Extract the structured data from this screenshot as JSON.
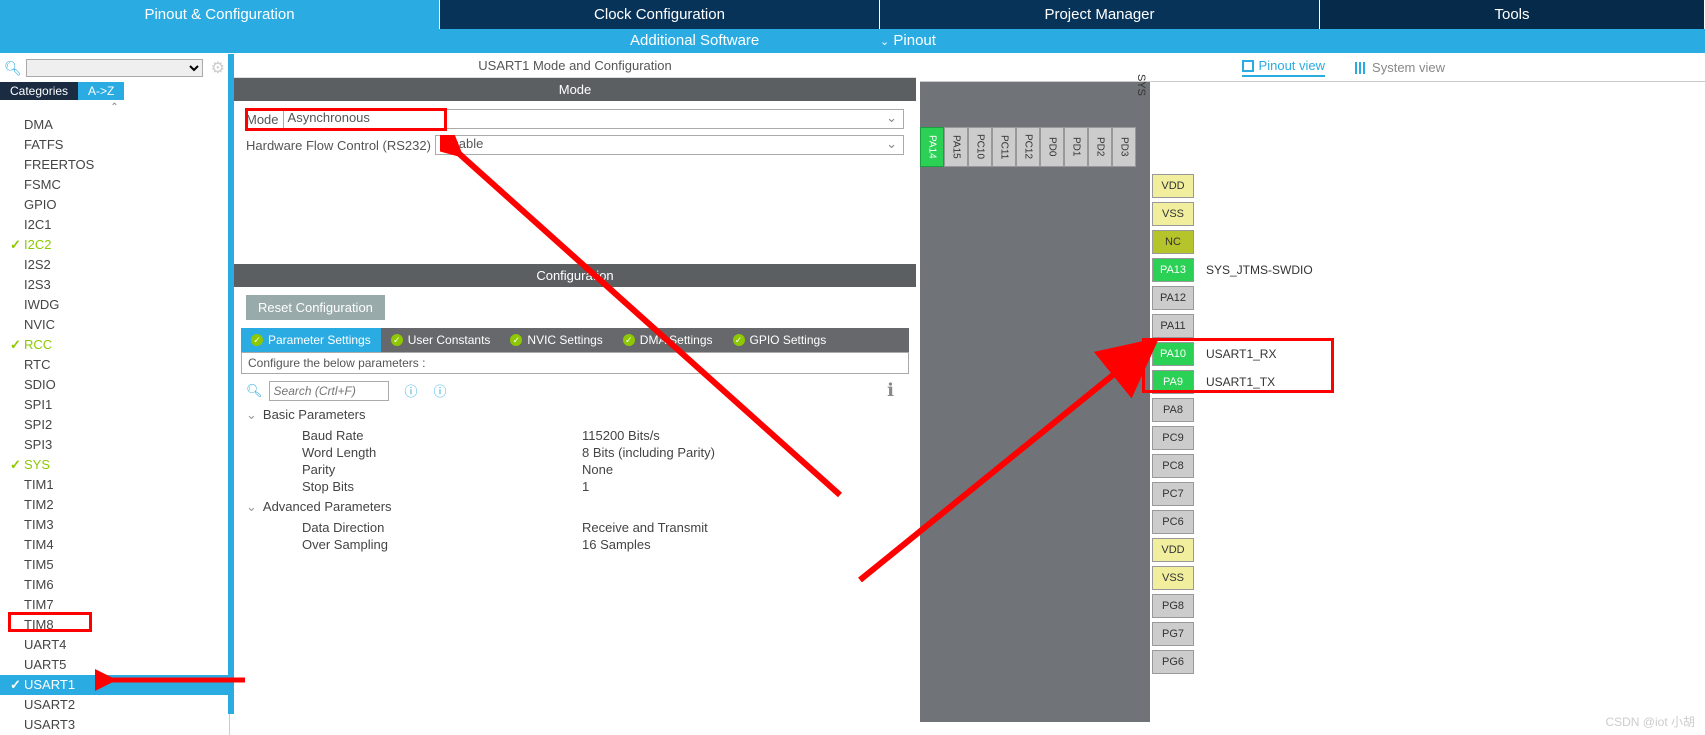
{
  "tabs": {
    "pinout": "Pinout & Configuration",
    "clock": "Clock Configuration",
    "project": "Project Manager",
    "tools": "Tools"
  },
  "sub": {
    "addsoft": "Additional Software",
    "pinout": "Pinout"
  },
  "left": {
    "cat": "Categories",
    "az": "A->Z",
    "items": [
      {
        "t": "DMA"
      },
      {
        "t": "FATFS"
      },
      {
        "t": "FREERTOS"
      },
      {
        "t": "FSMC"
      },
      {
        "t": "GPIO"
      },
      {
        "t": "I2C1"
      },
      {
        "t": "I2C2",
        "c": true
      },
      {
        "t": "I2S2"
      },
      {
        "t": "I2S3"
      },
      {
        "t": "IWDG"
      },
      {
        "t": "NVIC"
      },
      {
        "t": "RCC",
        "c": true
      },
      {
        "t": "RTC"
      },
      {
        "t": "SDIO"
      },
      {
        "t": "SPI1"
      },
      {
        "t": "SPI2"
      },
      {
        "t": "SPI3"
      },
      {
        "t": "SYS",
        "c": true
      },
      {
        "t": "TIM1"
      },
      {
        "t": "TIM2"
      },
      {
        "t": "TIM3"
      },
      {
        "t": "TIM4"
      },
      {
        "t": "TIM5"
      },
      {
        "t": "TIM6"
      },
      {
        "t": "TIM7"
      },
      {
        "t": "TIM8"
      },
      {
        "t": "UART4"
      },
      {
        "t": "UART5"
      },
      {
        "t": "USART1",
        "c": true,
        "sel": true
      },
      {
        "t": "USART2"
      },
      {
        "t": "USART3"
      }
    ]
  },
  "mid": {
    "title": "USART1 Mode and Configuration",
    "modehdr": "Mode",
    "mode_lbl": "Mode",
    "mode_val": "Asynchronous",
    "hw_lbl": "Hardware Flow Control (RS232)",
    "hw_val": "Disable",
    "confighdr": "Configuration",
    "reset": "Reset Configuration",
    "tabs": [
      "Parameter Settings",
      "User Constants",
      "NVIC Settings",
      "DMA Settings",
      "GPIO Settings"
    ],
    "desc": "Configure the below parameters :",
    "search_ph": "Search (Crtl+F)",
    "groups": {
      "basic": "Basic Parameters",
      "adv": "Advanced Parameters"
    },
    "params": [
      {
        "n": "Baud Rate",
        "v": "115200 Bits/s"
      },
      {
        "n": "Word Length",
        "v": "8 Bits (including Parity)"
      },
      {
        "n": "Parity",
        "v": "None"
      },
      {
        "n": "Stop Bits",
        "v": "1"
      }
    ],
    "params2": [
      {
        "n": "Data Direction",
        "v": "Receive and Transmit"
      },
      {
        "n": "Over Sampling",
        "v": "16 Samples"
      }
    ]
  },
  "right": {
    "pinoutview": "Pinout view",
    "systemview": "System view",
    "sys": "SYS",
    "top_pins": [
      "PD3",
      "PD2",
      "PD1",
      "PD0",
      "PC12",
      "PC11",
      "PC10",
      "PA15",
      "PA14"
    ],
    "side_pins": [
      {
        "p": "VDD",
        "cls": "yellow"
      },
      {
        "p": "VSS",
        "cls": "yellow"
      },
      {
        "p": "NC",
        "cls": "olive"
      },
      {
        "p": "PA13",
        "cls": "green",
        "lbl": "SYS_JTMS-SWDIO"
      },
      {
        "p": "PA12",
        "cls": ""
      },
      {
        "p": "PA11",
        "cls": ""
      },
      {
        "p": "PA10",
        "cls": "green",
        "lbl": "USART1_RX"
      },
      {
        "p": "PA9",
        "cls": "green",
        "lbl": "USART1_TX"
      },
      {
        "p": "PA8",
        "cls": ""
      },
      {
        "p": "PC9",
        "cls": ""
      },
      {
        "p": "PC8",
        "cls": ""
      },
      {
        "p": "PC7",
        "cls": ""
      },
      {
        "p": "PC6",
        "cls": ""
      },
      {
        "p": "VDD",
        "cls": "yellow"
      },
      {
        "p": "VSS",
        "cls": "yellow"
      },
      {
        "p": "PG8",
        "cls": ""
      },
      {
        "p": "PG7",
        "cls": ""
      },
      {
        "p": "PG6",
        "cls": ""
      }
    ]
  },
  "watermark": "CSDN @iot 小胡"
}
